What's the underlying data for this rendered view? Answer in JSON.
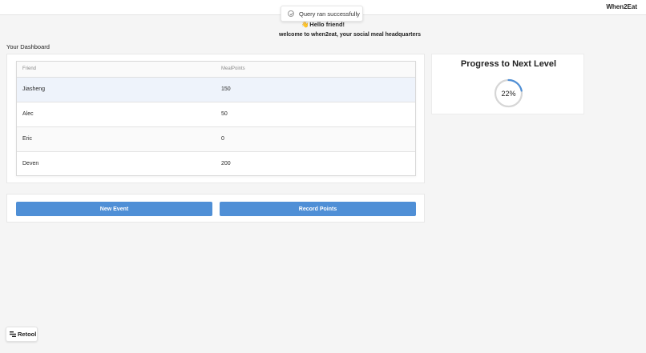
{
  "header": {
    "app_title": "When2Eat"
  },
  "toast": {
    "icon": "check-icon",
    "message": "Query ran successfully"
  },
  "greeting": {
    "wave": "👋",
    "hello": "Hello friend!",
    "welcome": "welcome to when2eat, your social meal headquarters"
  },
  "dashboard": {
    "label": "Your Dashboard"
  },
  "table": {
    "columns": [
      "Friend",
      "MealPoints"
    ],
    "rows": [
      {
        "friend": "Jiasheng",
        "points": "150"
      },
      {
        "friend": "Alec",
        "points": "50"
      },
      {
        "friend": "Eric",
        "points": "0"
      },
      {
        "friend": "Deven",
        "points": "200"
      }
    ],
    "selected_row": 0
  },
  "buttons": {
    "new_event": "New Event",
    "record_points": "Record Points"
  },
  "progress": {
    "title": "Progress to Next Level",
    "value": 22,
    "label": "22%"
  },
  "branding": {
    "retool_label": "Retool",
    "icon": "retool-logo-icon"
  },
  "colors": {
    "accent": "#4f8fd6",
    "selected_row": "#eef3fb",
    "ring_track": "#d6d6d6"
  }
}
